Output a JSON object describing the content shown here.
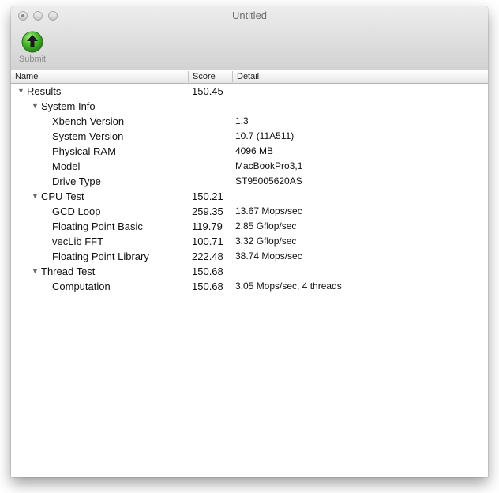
{
  "window": {
    "title": "Untitled"
  },
  "toolbar": {
    "submit_label": "Submit",
    "submit_icon": "upload-arrow-icon",
    "accent": "#2f9e1f"
  },
  "columns": {
    "name": "Name",
    "score": "Score",
    "detail": "Detail"
  },
  "rows": [
    {
      "name": "Results",
      "score": "150.45",
      "detail": "",
      "level": 0,
      "expandable": true
    },
    {
      "name": "System Info",
      "score": "",
      "detail": "",
      "level": 1,
      "expandable": true
    },
    {
      "name": "Xbench Version",
      "score": "",
      "detail": "1.3",
      "level": 2,
      "expandable": false
    },
    {
      "name": "System Version",
      "score": "",
      "detail": "10.7 (11A511)",
      "level": 2,
      "expandable": false
    },
    {
      "name": "Physical RAM",
      "score": "",
      "detail": "4096 MB",
      "level": 2,
      "expandable": false
    },
    {
      "name": "Model",
      "score": "",
      "detail": "MacBookPro3,1",
      "level": 2,
      "expandable": false
    },
    {
      "name": "Drive Type",
      "score": "",
      "detail": "ST95005620AS",
      "level": 2,
      "expandable": false
    },
    {
      "name": "CPU Test",
      "score": "150.21",
      "detail": "",
      "level": 1,
      "expandable": true
    },
    {
      "name": "GCD Loop",
      "score": "259.35",
      "detail": "13.67 Mops/sec",
      "level": 2,
      "expandable": false
    },
    {
      "name": "Floating Point Basic",
      "score": "119.79",
      "detail": "2.85 Gflop/sec",
      "level": 2,
      "expandable": false
    },
    {
      "name": "vecLib FFT",
      "score": "100.71",
      "detail": "3.32 Gflop/sec",
      "level": 2,
      "expandable": false
    },
    {
      "name": "Floating Point Library",
      "score": "222.48",
      "detail": "38.74 Mops/sec",
      "level": 2,
      "expandable": false
    },
    {
      "name": "Thread Test",
      "score": "150.68",
      "detail": "",
      "level": 1,
      "expandable": true
    },
    {
      "name": "Computation",
      "score": "150.68",
      "detail": "3.05 Mops/sec, 4 threads",
      "level": 2,
      "expandable": false
    }
  ]
}
